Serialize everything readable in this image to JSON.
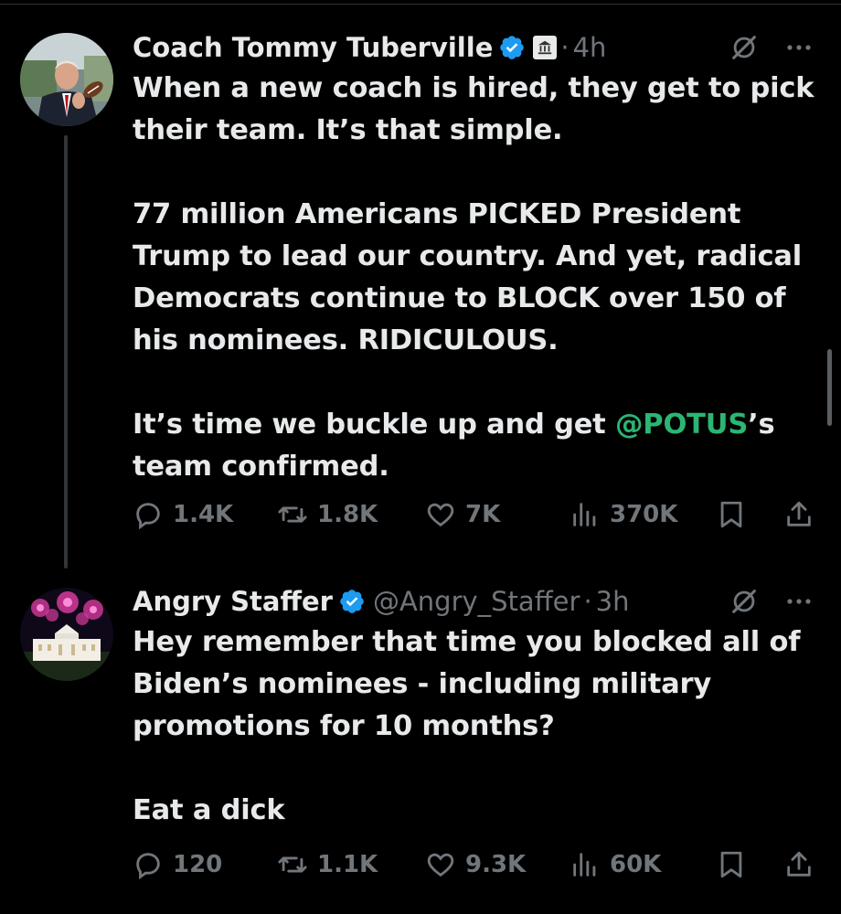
{
  "tweets": [
    {
      "author": "Coach Tommy Tuberville",
      "handle": "",
      "dot": "·",
      "time": "4h",
      "lines": [
        "When a new coach is hired, they get to pick",
        "their team. It’s that simple.",
        "",
        "77 million Americans PICKED President",
        "Trump to lead our country. And yet, radical",
        "Democrats continue to BLOCK over 150 of",
        "his nominees. RIDICULOUS.",
        "",
        "It’s time we buckle up and get "
      ],
      "mention": "@POTUS",
      "after_mention": "’s",
      "last_line": "team confirmed.",
      "replies": "1.4K",
      "reposts": "1.8K",
      "likes": "7K",
      "views": "370K"
    },
    {
      "author": "Angry Staffer",
      "handle": "@Angry_Staffer",
      "dot": "·",
      "time": "3h",
      "lines": [
        "Hey remember that time you blocked all of",
        "Biden’s nominees - including military",
        "promotions for 10 months?",
        "",
        "Eat a dick"
      ],
      "replies": "120",
      "reposts": "1.1K",
      "likes": "9.3K",
      "views": "60K"
    }
  ],
  "colors": {
    "background": "#000000",
    "text": "#e7e9ea",
    "muted": "#71767b",
    "verified": "#1d9bf0",
    "mention": "#2bb673"
  },
  "icons": [
    "verified-badge-icon",
    "government-affiliation-icon",
    "grok-icon",
    "more-icon",
    "reply-icon",
    "repost-icon",
    "like-icon",
    "views-icon",
    "bookmark-icon",
    "share-icon"
  ]
}
